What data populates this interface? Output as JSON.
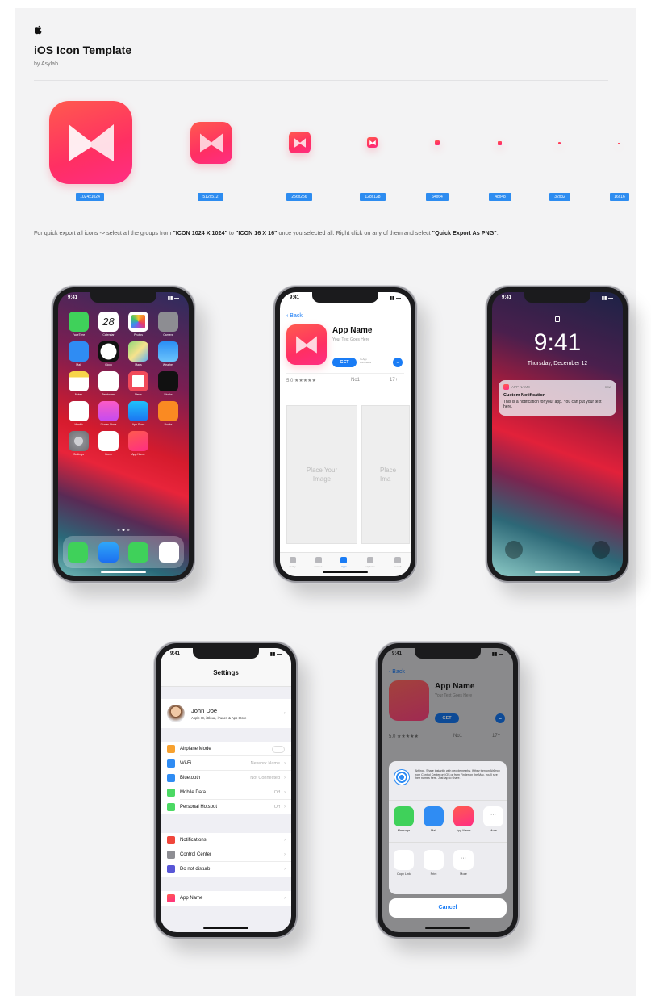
{
  "header": {
    "title": "iOS Icon Template",
    "byline": "by Asylab"
  },
  "icon_sizes": [
    "1024x1024",
    "512x512",
    "256x256",
    "128x128",
    "64x64",
    "48x48",
    "32x32",
    "16x16"
  ],
  "instruction": {
    "part1": "For quick export all icons -> select all the groups from ",
    "bold1": "\"ICON 1024 X 1024\"",
    "part2": " to ",
    "bold2": "\"ICON 16 X 16\"",
    "part3": " once you selected all. Right click on any of them and select ",
    "bold3": "\"Quick Export As PNG\"",
    "part4": "."
  },
  "status_time": "9:41",
  "home": {
    "calendar_day": "28",
    "apps": [
      "FaceTime",
      "Calendar",
      "Photos",
      "Camera",
      "Mail",
      "Clock",
      "Maps",
      "Weather",
      "Notes",
      "Reminders",
      "News",
      "Stocks",
      "Health",
      "iTunes Store",
      "App Store",
      "Books",
      "Settings",
      "Home",
      "App Name"
    ]
  },
  "appstore": {
    "back": "Back",
    "app_name": "App Name",
    "subtitle": "Your Text Goes Here",
    "get": "GET",
    "in_app": "In-App Purchases",
    "rating": "5.0 ★★★★★",
    "rank": "No1",
    "age": "17+",
    "placeholder_line1": "Place Your",
    "placeholder_line2": "Image",
    "placeholder_partial_line1": "Place",
    "placeholder_partial_line2": "Ima",
    "tabs": [
      "Today",
      "Games",
      "Apps",
      "Updates",
      "Search"
    ]
  },
  "lock": {
    "time": "9:41",
    "date": "Thursday, December 12",
    "notif_app": "APP NAME",
    "notif_when": "now",
    "notif_title": "Custom Notification",
    "notif_body": "This is a notification for your app. You can put your text here."
  },
  "settings": {
    "title": "Settings",
    "user_name": "John Doe",
    "user_sub": "Apple ID, iCloud, iTunes & App Store",
    "rows": [
      {
        "label": "Airplane Mode",
        "value": ""
      },
      {
        "label": "Wi-Fi",
        "value": "Network Name"
      },
      {
        "label": "Bluetooth",
        "value": "Not Connected"
      },
      {
        "label": "Mobile Data",
        "value": "Off"
      },
      {
        "label": "Personal Hotspot",
        "value": "Off"
      },
      {
        "label": "Notifications",
        "value": ""
      },
      {
        "label": "Control Center",
        "value": ""
      },
      {
        "label": "Do not disturb",
        "value": ""
      },
      {
        "label": "App Name",
        "value": ""
      }
    ]
  },
  "share": {
    "back": "Back",
    "app_name": "App Name",
    "subtitle": "Your Text Goes Here",
    "get": "GET",
    "rating": "5.0 ★★★★★",
    "rank": "No1",
    "age": "17+",
    "airdrop": "AirDrop. Share instantly with people nearby. If they turn on AirDrop from Control Center on iOS or from Finder on the Mac, you'll see their names here. Just tap to share.",
    "row1": [
      "Message",
      "Mail",
      "App Name",
      "More"
    ],
    "row2": [
      "Copy Link",
      "Print",
      "More"
    ],
    "cancel": "Cancel"
  },
  "colors": {
    "icon_top": "#ff5a4e",
    "icon_bottom": "#ff2d84",
    "ios_blue": "#1a7cf5",
    "size_tag": "#2d8cf0"
  }
}
